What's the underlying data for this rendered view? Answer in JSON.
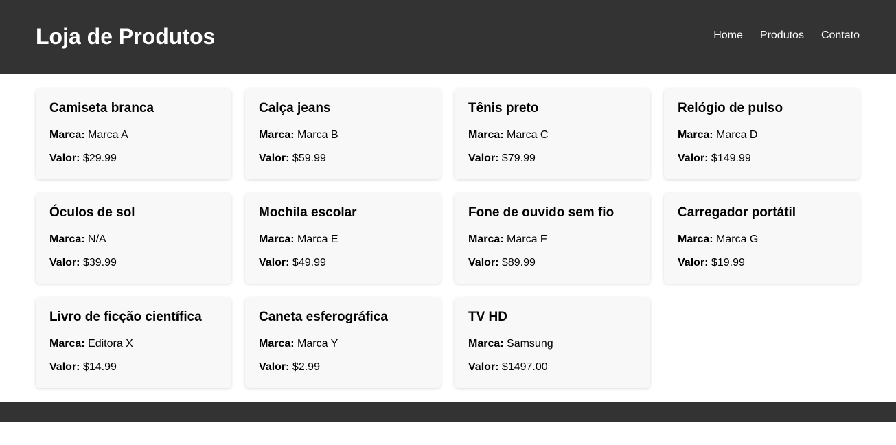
{
  "header": {
    "title": "Loja de Produtos",
    "nav": [
      "Home",
      "Produtos",
      "Contato"
    ]
  },
  "labels": {
    "brand": "Marca:",
    "price": "Valor:"
  },
  "products": [
    {
      "name": "Camiseta branca",
      "brand": "Marca A",
      "price": "$29.99"
    },
    {
      "name": "Calça jeans",
      "brand": "Marca B",
      "price": "$59.99"
    },
    {
      "name": "Tênis preto",
      "brand": "Marca C",
      "price": "$79.99"
    },
    {
      "name": "Relógio de pulso",
      "brand": "Marca D",
      "price": "$149.99"
    },
    {
      "name": "Óculos de sol",
      "brand": "N/A",
      "price": "$39.99"
    },
    {
      "name": "Mochila escolar",
      "brand": "Marca E",
      "price": "$49.99"
    },
    {
      "name": "Fone de ouvido sem fio",
      "brand": "Marca F",
      "price": "$89.99"
    },
    {
      "name": "Carregador portátil",
      "brand": "Marca G",
      "price": "$19.99"
    },
    {
      "name": "Livro de ficção científica",
      "brand": "Editora X",
      "price": "$14.99"
    },
    {
      "name": "Caneta esferográfica",
      "brand": "Marca Y",
      "price": "$2.99"
    },
    {
      "name": "TV HD",
      "brand": "Samsung",
      "price": "$1497.00"
    }
  ],
  "colors": {
    "header_bg": "#333333",
    "card_bg": "#f8f8f8",
    "footer_bg": "#333333"
  }
}
